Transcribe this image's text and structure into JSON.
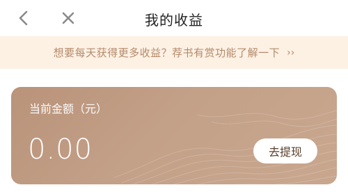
{
  "navbar": {
    "back_icon": "chevron-left-icon",
    "close_icon": "close-icon",
    "title": "我的收益"
  },
  "banner": {
    "text": "想要每天获得更多收益？荐书有赏功能了解一下",
    "arrow": "››"
  },
  "card": {
    "label": "当前金额（元）",
    "amount": "0.00",
    "withdraw_label": "去提现"
  },
  "colors": {
    "banner_bg": "#fdf1e4",
    "banner_text": "#b48a6a",
    "card_start": "#b9937a",
    "card_end": "#c9a78f"
  }
}
